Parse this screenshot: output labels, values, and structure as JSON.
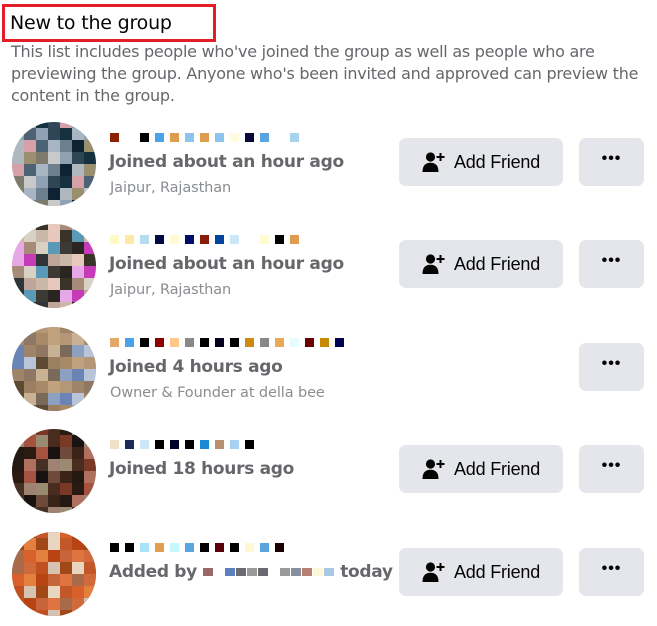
{
  "section": {
    "title": "New to the group",
    "description": "This list includes people who've joined the group as well as people who are previewing the group. Anyone who's been invited and approved can preview the content in the group."
  },
  "buttons": {
    "add_friend_label": "Add Friend",
    "more_label": "•••"
  },
  "members": [
    {
      "name": "[redacted]",
      "status": "Joined about an hour ago",
      "subtitle": "Jaipur, Rajasthan",
      "has_add_friend": true,
      "avatar_colors": [
        "#8fa1b3",
        "#2f4656",
        "#15313f",
        "#d6a0a8",
        "#4d6274",
        "#a8b6c4",
        "#6c7f8f",
        "#0d2233",
        "#b0b8bf",
        "#9a9070",
        "#7e7b6c",
        "#c9c9c9"
      ],
      "name_colors": [
        "#8b2200",
        "#ffffff",
        "#000000",
        "#4aa3e8",
        "#e09c4e",
        "#8cc4ec",
        "#e09c4e",
        "#8cc4ec",
        "#fffbe0",
        "#06063a",
        "#5aa4df",
        "#ffffff",
        "#a8d3ee"
      ]
    },
    {
      "name": "[redacted]",
      "status": "Joined about an hour ago",
      "subtitle": "Jaipur, Rajasthan",
      "has_add_friend": true,
      "avatar_colors": [
        "#c9b7a8",
        "#e8c8bc",
        "#3a3328",
        "#a58b78",
        "#d9d1c3",
        "#5a9ab8",
        "#3d3a36",
        "#2a2520",
        "#e6a8e6",
        "#c73bb8",
        "#2e3438",
        "#bfa59a"
      ],
      "name_colors": [
        "#fff9c4",
        "#ffe7a8",
        "#b6dcf0",
        "#020a44",
        "#fffbd0",
        "#000c6a",
        "#8b1c0a",
        "#0044a0",
        "#cce8f8",
        "#ffffff",
        "#fffbd0",
        "#000000",
        "#e09c4e"
      ]
    },
    {
      "name": "[redacted]",
      "status": "Joined 4 hours ago",
      "subtitle": "Owner & Founder at della bee",
      "has_add_friend": false,
      "avatar_colors": [
        "#a88a68",
        "#c2a27e",
        "#b49776",
        "#a08468",
        "#8e7864",
        "#c8b293",
        "#7a6a5a",
        "#8ea0c0",
        "#6a84b6",
        "#b8c4d8",
        "#5c4a34",
        "#9a7f60"
      ],
      "name_colors": [
        "#e3a86a",
        "#4aa3e8",
        "#000000",
        "#8b0000",
        "#ffc88a",
        "#888888",
        "#000000",
        "#03031f",
        "#000000",
        "#d08a10",
        "#888888",
        "#e8a858",
        "#e6fcff",
        "#6a0000",
        "#c88800",
        "#020252"
      ]
    },
    {
      "name": "[redacted]",
      "status": "Joined 18 hours ago",
      "subtitle": "",
      "has_add_friend": true,
      "avatar_colors": [
        "#9a8a72",
        "#4a2c1e",
        "#7a3826",
        "#2a1a12",
        "#a65240",
        "#1a1210",
        "#6e4a3a",
        "#3a2418",
        "#241812",
        "#b07060",
        "#463024",
        "#a08272"
      ],
      "name_colors": [
        "#f0e0c8",
        "#1a2a5a",
        "#cce8f8",
        "#000000",
        "#000028",
        "#000000",
        "#1a8ad4",
        "#b89070",
        "#a8d0f0",
        "#000000"
      ]
    },
    {
      "name": "[redacted]",
      "status_prefix": "Added by",
      "status_suffix": "today",
      "added_by": "[redacted]",
      "subtitle": "",
      "has_add_friend": true,
      "avatar_colors": [
        "#a04818",
        "#e8d6c0",
        "#c2582a",
        "#d8602a",
        "#e4803e",
        "#b84414",
        "#c8643a",
        "#e07440",
        "#a86a48",
        "#d06a3a",
        "#c05020",
        "#d6c2b0"
      ],
      "name_colors": [
        "#000000",
        "#000000",
        "#a8e4f8",
        "#e0a050",
        "#c8f8ff",
        "#5aa4df",
        "#000000",
        "#5a0008",
        "#000000",
        "#fff8d0",
        "#5aa4df",
        "#1a0004"
      ],
      "added_by_colors": [
        "#9a6a6a",
        "#ffffff",
        "#5a80c0",
        "#6a6a70",
        "#9a9a9a",
        "#6a6a70",
        "#ffffff",
        "#9a9a9a",
        "#8890a0",
        "#b88070",
        "#fff8d8",
        "#a8c8e8"
      ]
    }
  ]
}
